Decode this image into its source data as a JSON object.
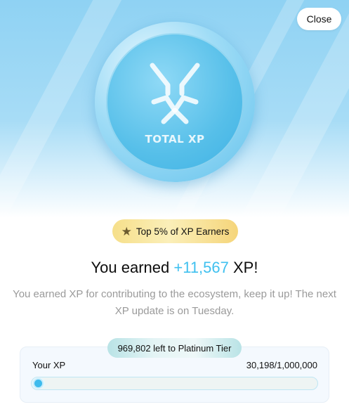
{
  "header": {
    "close_label": "Close"
  },
  "coin": {
    "label": "TOTAL XP",
    "icon": "total-xp-logo-icon"
  },
  "badge": {
    "icon": "star-icon",
    "text": "Top 5% of XP Earners"
  },
  "headline": {
    "prefix": "You earned ",
    "amount": "+11,567",
    "suffix": " XP!"
  },
  "description": "You earned XP for contributing to the ecosystem, keep it up! The next XP update is on Tuesday.",
  "progress": {
    "pill_text": "969,802 left to Platinum Tier",
    "label": "Your XP",
    "value_text": "30,198/1,000,000",
    "current": 30198,
    "max": 1000000,
    "fraction": 0.030198
  },
  "colors": {
    "accent": "#3fc0ef",
    "badge_gold": "#f5d57a",
    "hero_blue": "#8fd2f3"
  }
}
